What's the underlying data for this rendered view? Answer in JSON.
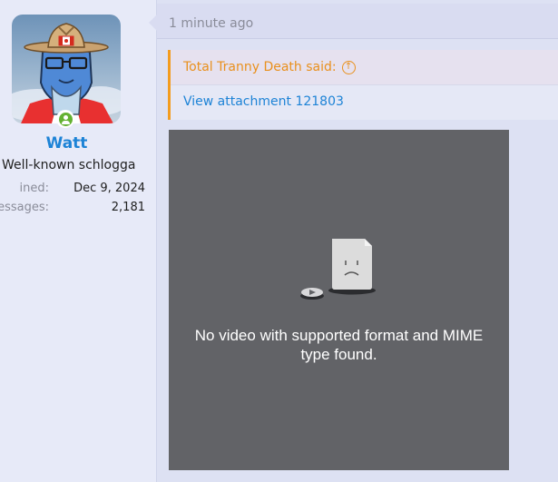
{
  "user": {
    "name": "Watt",
    "title": "Well-known schlogga",
    "stats": [
      {
        "label": "ined:",
        "value": "Dec 9, 2024"
      },
      {
        "label": "essages:",
        "value": "2,181"
      }
    ]
  },
  "post": {
    "time": "1 minute ago",
    "quote": {
      "author": "Total Tranny Death said:",
      "link": "View attachment 121803"
    },
    "video": {
      "message_line1": "No video with supported format and MIME",
      "message_line2": "type found."
    }
  },
  "icons": {
    "online": "online-status-icon",
    "quote_up": "arrow-up-circle-icon",
    "broken_file": "sad-file-icon"
  },
  "colors": {
    "username": "#1d83d6",
    "quote_accent": "#f39c1f",
    "link": "#1d83d6",
    "video_bg": "#626367"
  }
}
